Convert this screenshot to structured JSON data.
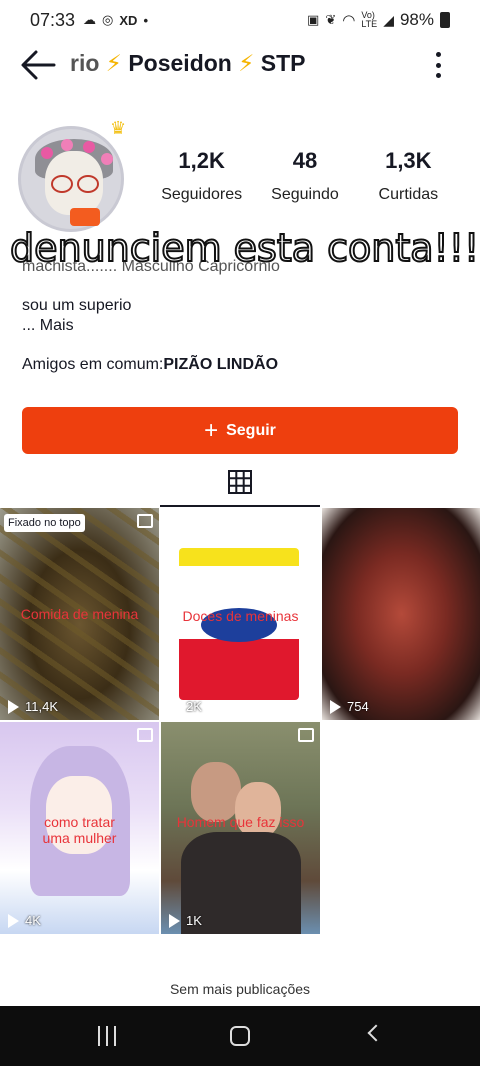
{
  "status_bar": {
    "time": "07:33",
    "battery": "98%",
    "left_icons": [
      "cloud-icon",
      "instagram-icon",
      "xd-icon",
      "dot-icon"
    ],
    "right_icons": [
      "nfc-icon",
      "leaf-icon",
      "wifi-icon",
      "volte-icon",
      "signal-icon",
      "battery-icon"
    ]
  },
  "header": {
    "title_prefix": "rio",
    "title_name": "Poseidon",
    "title_suffix": "STP",
    "bolt_symbol": "⚡"
  },
  "stats": [
    {
      "value": "1,2K",
      "label": "Seguidores"
    },
    {
      "value": "48",
      "label": "Seguindo"
    },
    {
      "value": "1,3K",
      "label": "Curtidas"
    }
  ],
  "overlay_text": "denunciem esta conta!!!",
  "hidden_line": "machista....... Masculino Capricórnio",
  "bio": {
    "line1": "sou um superio",
    "more": "...  Mais"
  },
  "friends": {
    "prefix": "Amigos em comum:",
    "name": "PIZÃO LINDÃO"
  },
  "follow_button": {
    "label": "Seguir",
    "color": "#ee3f0e"
  },
  "videos": [
    {
      "caption": "Comida de menina",
      "views": "11,4K",
      "pinned": "Fixado no topo"
    },
    {
      "caption": "Doces de meninas",
      "views": "2K"
    },
    {
      "caption": "",
      "views": "754"
    },
    {
      "caption": "como tratar uma mulher",
      "views": "4K"
    },
    {
      "caption": "Homem que faz isso",
      "views": "1K"
    }
  ],
  "footer_text": "Sem mais publicações"
}
